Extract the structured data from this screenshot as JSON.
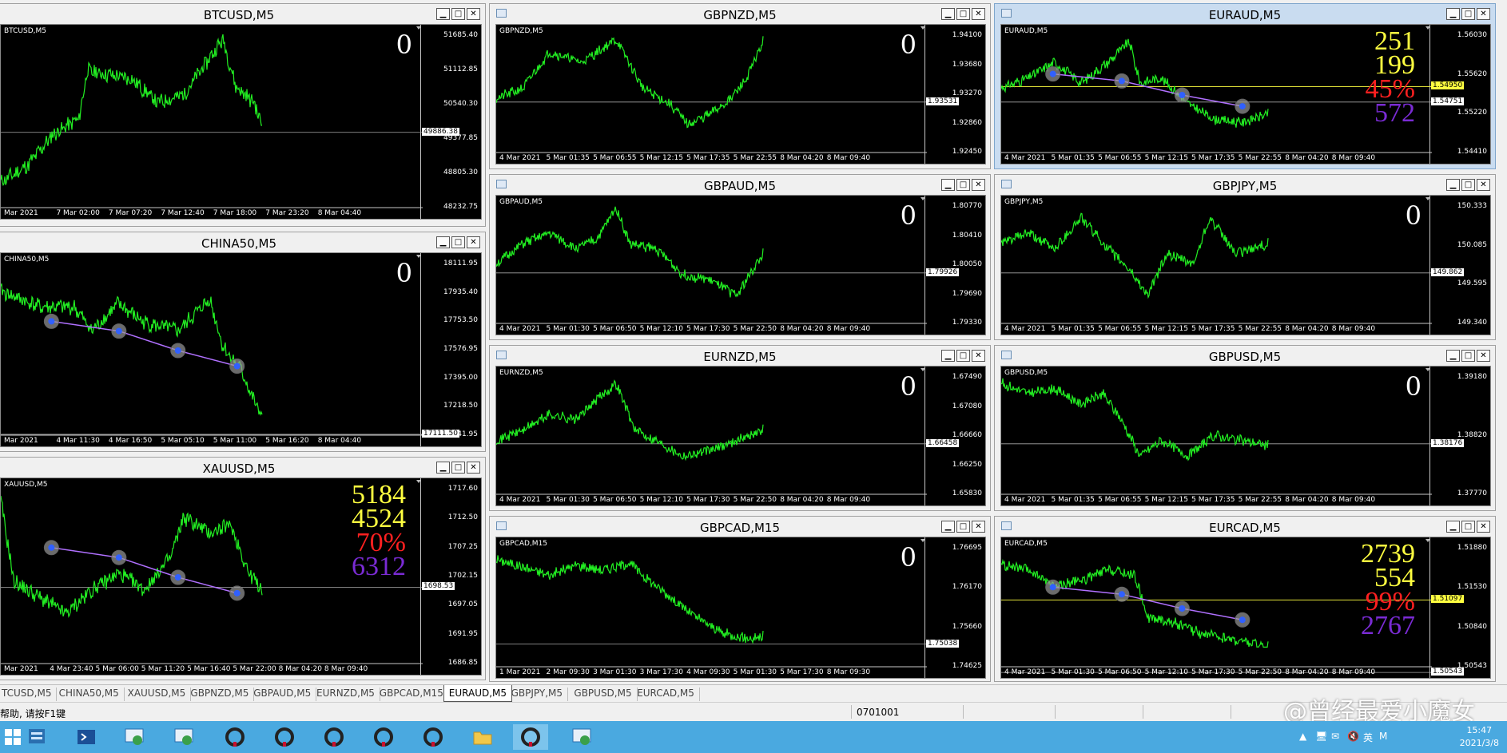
{
  "windows": [
    {
      "id": "btcusd",
      "title": "BTCUSD,M5",
      "symbol": "BTCUSD,M5",
      "active": false,
      "yticks": [
        "51685.40",
        "51112.85",
        "50540.30",
        "49377.85",
        "48805.30",
        "48232.75"
      ],
      "ybox": "49886.38",
      "xticks": [
        "Mar 2021",
        "7 Mar 02:00",
        "7 Mar 07:20",
        "7 Mar 12:40",
        "7 Mar 18:00",
        "7 Mar 23:20",
        "8 Mar 04:40"
      ],
      "counter": "0",
      "stats": null,
      "seed": 11,
      "trend": "btc",
      "markers": false
    },
    {
      "id": "gbpnzd",
      "title": "GBPNZD,M5",
      "symbol": "GBPNZD,M5",
      "active": false,
      "yticks": [
        "1.94100",
        "1.93680",
        "1.93270",
        "1.92860",
        "1.92450"
      ],
      "ybox": "1.93531",
      "xticks": [
        "4 Mar 2021",
        "5 Mar 01:35",
        "5 Mar 06:55",
        "5 Mar 12:15",
        "5 Mar 17:35",
        "5 Mar 22:55",
        "8 Mar 04:20",
        "8 Mar 09:40"
      ],
      "counter": "0",
      "stats": null,
      "seed": 21,
      "trend": "gbpnzd",
      "markers": false
    },
    {
      "id": "euraud",
      "title": "EURAUD,M5",
      "symbol": "EURAUD,M5",
      "active": true,
      "yticks": [
        "1.56030",
        "1.55620",
        "1.55220",
        "1.54410"
      ],
      "ybox": "1.54751",
      "ybox_yellow": "1.54950",
      "xticks": [
        "4 Mar 2021",
        "5 Mar 01:35",
        "5 Mar 06:55",
        "5 Mar 12:15",
        "5 Mar 17:35",
        "5 Mar 22:55",
        "8 Mar 04:20",
        "8 Mar 09:40"
      ],
      "counter": null,
      "stats": [
        "251",
        "199",
        "45%",
        "572"
      ],
      "seed": 31,
      "trend": "euraud",
      "markers": true
    },
    {
      "id": "china50",
      "title": "CHINA50,M5",
      "symbol": "CHINA50,M5",
      "active": false,
      "yticks": [
        "18111.95",
        "17935.40",
        "17753.50",
        "17576.95",
        "17395.00",
        "17218.50",
        "17041.95"
      ],
      "ybox": "17111.50",
      "xticks": [
        "Mar 2021",
        "4 Mar 11:30",
        "4 Mar 16:50",
        "5 Mar 05:10",
        "5 Mar 11:00",
        "5 Mar 16:20",
        "8 Mar 04:40"
      ],
      "counter": "0",
      "stats": null,
      "seed": 41,
      "trend": "china",
      "markers": true
    },
    {
      "id": "gbpaud",
      "title": "GBPAUD,M5",
      "symbol": "GBPAUD,M5",
      "active": false,
      "yticks": [
        "1.80770",
        "1.80410",
        "1.80050",
        "1.79690",
        "1.79330"
      ],
      "ybox": "1.79926",
      "xticks": [
        "4 Mar 2021",
        "5 Mar 01:30",
        "5 Mar 06:50",
        "5 Mar 12:10",
        "5 Mar 17:30",
        "5 Mar 22:50",
        "8 Mar 04:20",
        "8 Mar 09:40"
      ],
      "counter": "0",
      "stats": null,
      "seed": 51,
      "trend": "gbpaud",
      "markers": false
    },
    {
      "id": "gbpjpy",
      "title": "GBPJPY,M5",
      "symbol": "GBPJPY,M5",
      "active": false,
      "yticks": [
        "150.333",
        "150.085",
        "149.595",
        "149.340"
      ],
      "ybox": "149.862",
      "xticks": [
        "4 Mar 2021",
        "5 Mar 01:35",
        "5 Mar 06:55",
        "5 Mar 12:15",
        "5 Mar 17:35",
        "5 Mar 22:55",
        "8 Mar 04:20",
        "8 Mar 09:40"
      ],
      "counter": "0",
      "stats": null,
      "seed": 61,
      "trend": "gbpjpy",
      "markers": false
    },
    {
      "id": "eurnzd",
      "title": "EURNZD,M5",
      "symbol": "EURNZD,M5",
      "active": false,
      "yticks": [
        "1.67490",
        "1.67080",
        "1.66660",
        "1.66250",
        "1.65830"
      ],
      "ybox": "1.66458",
      "xticks": [
        "4 Mar 2021",
        "5 Mar 01:30",
        "5 Mar 06:50",
        "5 Mar 12:10",
        "5 Mar 17:30",
        "5 Mar 22:50",
        "8 Mar 04:20",
        "8 Mar 09:40"
      ],
      "counter": "0",
      "stats": null,
      "seed": 71,
      "trend": "eurnzd",
      "markers": false
    },
    {
      "id": "gbpusd",
      "title": "GBPUSD,M5",
      "symbol": "GBPUSD,M5",
      "active": false,
      "yticks": [
        "1.39180",
        "1.38820",
        "1.37770"
      ],
      "ybox": "1.38176",
      "xticks": [
        "4 Mar 2021",
        "5 Mar 01:35",
        "5 Mar 06:55",
        "5 Mar 12:15",
        "5 Mar 17:35",
        "5 Mar 22:55",
        "8 Mar 04:20",
        "8 Mar 09:40"
      ],
      "counter": "0",
      "stats": null,
      "seed": 81,
      "trend": "gbpusd",
      "markers": false
    },
    {
      "id": "xauusd",
      "title": "XAUUSD,M5",
      "symbol": "XAUUSD,M5",
      "active": false,
      "yticks": [
        "1717.60",
        "1712.50",
        "1707.25",
        "1702.15",
        "1697.05",
        "1691.95",
        "1686.85"
      ],
      "ybox": "1698.53",
      "xticks": [
        "Mar 2021",
        "4 Mar 23:40",
        "5 Mar 06:00",
        "5 Mar 11:20",
        "5 Mar 16:40",
        "5 Mar 22:00",
        "8 Mar 04:20",
        "8 Mar 09:40"
      ],
      "counter": null,
      "stats": [
        "5184",
        "4524",
        "70%",
        "6312"
      ],
      "seed": 91,
      "trend": "xau",
      "markers": true
    },
    {
      "id": "gbpcad",
      "title": "GBPCAD,M15",
      "symbol": "GBPCAD,M15",
      "active": false,
      "yticks": [
        "1.76695",
        "1.76170",
        "1.75660",
        "1.74625"
      ],
      "ybox": "1.75038",
      "xticks": [
        "1 Mar 2021",
        "2 Mar 09:30",
        "3 Mar 01:30",
        "3 Mar 17:30",
        "4 Mar 09:30",
        "5 Mar 01:30",
        "5 Mar 17:30",
        "8 Mar 09:30"
      ],
      "counter": "0",
      "stats": null,
      "seed": 101,
      "trend": "gbpcad",
      "markers": false
    },
    {
      "id": "eurcad",
      "title": "EURCAD,M5",
      "symbol": "EURCAD,M5",
      "active": false,
      "yticks": [
        "1.51880",
        "1.51530",
        "1.50840",
        "1.50543"
      ],
      "ybox": "1.50543",
      "ybox_yellow": "1.51097",
      "xticks": [
        "4 Mar 2021",
        "5 Mar 01:30",
        "5 Mar 06:50",
        "5 Mar 12:10",
        "5 Mar 17:30",
        "5 Mar 22:50",
        "8 Mar 04:20",
        "8 Mar 09:40"
      ],
      "counter": null,
      "stats": [
        "2739",
        "554",
        "99%",
        "2767"
      ],
      "seed": 111,
      "trend": "eurcad",
      "markers": true
    }
  ],
  "tabs": [
    "TCUSD,M5",
    "CHINA50,M5",
    "XAUUSD,M5",
    "GBPNZD,M5",
    "GBPAUD,M5",
    "EURNZD,M5",
    "GBPCAD,M15",
    "EURAUD,M5",
    "GBPJPY,M5",
    "GBPUSD,M5",
    "EURCAD,M5"
  ],
  "selected_tab": "EURAUD,M5",
  "status": {
    "help": "帮助, 请按F1键",
    "value": "0701001"
  },
  "watermark": "@曾经最爱小魔女",
  "clock": {
    "time": "15:47",
    "date": "2021/3/8"
  },
  "tray": [
    "▲",
    "🖥",
    "✉",
    "🔇",
    "英",
    "M"
  ],
  "colors": {
    "line": "#22ee22",
    "bg": "#000000",
    "marker": "#b070ff"
  }
}
